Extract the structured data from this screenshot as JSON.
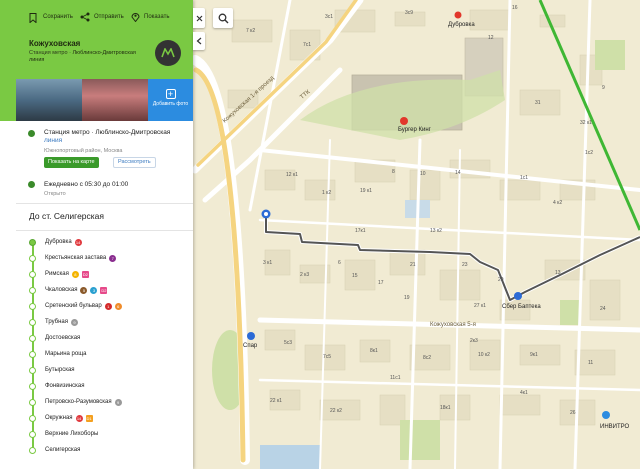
{
  "panel": {
    "actions": [
      {
        "label": "Сохранить",
        "icon": "bookmark-icon"
      },
      {
        "label": "Отправить",
        "icon": "share-icon"
      },
      {
        "label": "Показать",
        "icon": "pin-icon"
      }
    ],
    "title": "Кожуховская",
    "subtitle_prefix": "Станция метро · ",
    "subtitle_line": "Люблинско-Дмитровская линия",
    "photo_add_label": "Добавить фото",
    "metro_type": "Станция метро · Люблинско-Дмитровская",
    "metro_line_cont": "линия",
    "district": "Южнопортовый район, Москва",
    "show_on_map": "Показать на карте",
    "view": "Рассмотреть",
    "hours": "Ежедневно с 05:30 до 01:00",
    "status": "Открыто",
    "route_title": "До ст. Селигерская",
    "stations": [
      {
        "name": "Дубровка",
        "badges": [
          {
            "text": "14",
            "color": "#e0393e"
          }
        ]
      },
      {
        "name": "Крестьянская застава",
        "badges": [
          {
            "text": "7",
            "color": "#8a2d8f"
          }
        ]
      },
      {
        "name": "Римская",
        "badges": [
          {
            "text": "8",
            "color": "#f4b400"
          },
          {
            "text": "D2",
            "color": "#e64a8a",
            "sq": true
          }
        ]
      },
      {
        "name": "Чкаловская",
        "badges": [
          {
            "text": "5",
            "color": "#8b5a2b"
          },
          {
            "text": "3",
            "color": "#2aa0d0"
          },
          {
            "text": "D2",
            "color": "#e64a8a",
            "sq": true
          }
        ]
      },
      {
        "name": "Сретенский бульвар",
        "badges": [
          {
            "text": "1",
            "color": "#d42a2a"
          },
          {
            "text": "6",
            "color": "#f08c2a"
          }
        ]
      },
      {
        "name": "Трубная",
        "badges": [
          {
            "text": "9",
            "color": "#999999"
          }
        ]
      },
      {
        "name": "Достоевская",
        "badges": []
      },
      {
        "name": "Марьина роща",
        "badges": []
      },
      {
        "name": "Бутырская",
        "badges": []
      },
      {
        "name": "Фонвизинская",
        "badges": []
      },
      {
        "name": "Петровско-Разумовская",
        "badges": [
          {
            "text": "9",
            "color": "#999999"
          }
        ]
      },
      {
        "name": "Окружная",
        "badges": [
          {
            "text": "14",
            "color": "#e0393e"
          },
          {
            "text": "D1",
            "color": "#f4a020",
            "sq": true
          }
        ]
      },
      {
        "name": "Верхние Лихоборы",
        "badges": []
      },
      {
        "name": "Селигерская",
        "badges": []
      }
    ]
  },
  "map": {
    "pois": {
      "burger": "Бургер Кинг",
      "sber": "Сбер Баптека",
      "spar": "Спар",
      "invitro": "ИНВИТРО",
      "dubrovka": "Дубровка"
    },
    "streets": {
      "kozhukh5": "Кожуховская 5-я",
      "kozhukh1": "Кожуховская 1-я проезд",
      "ttk": "ТТК"
    },
    "house_numbers": [
      "7 к2",
      "7с1",
      "3с1",
      "1 к2",
      "12 к1",
      "8",
      "10",
      "14",
      "1с1",
      "4 к2",
      "2 к3",
      "6",
      "3 к1",
      "19 к1",
      "17",
      "21",
      "23",
      "15",
      "27 к1",
      "29",
      "19",
      "24",
      "5с3",
      "7с5",
      "8к1",
      "8с2",
      "10 к2",
      "9к1",
      "11",
      "13",
      "12",
      "16",
      "31",
      "32 к1",
      "1с2",
      "3с9",
      "2к3",
      "4к1",
      "22 к1",
      "22 к2",
      "18к1",
      "26",
      "17к1",
      "13 к2",
      "11с1",
      "9"
    ]
  },
  "colors": {
    "panel_header": "#7ac943",
    "route": "#555555",
    "metro_line": "#7ac943"
  }
}
